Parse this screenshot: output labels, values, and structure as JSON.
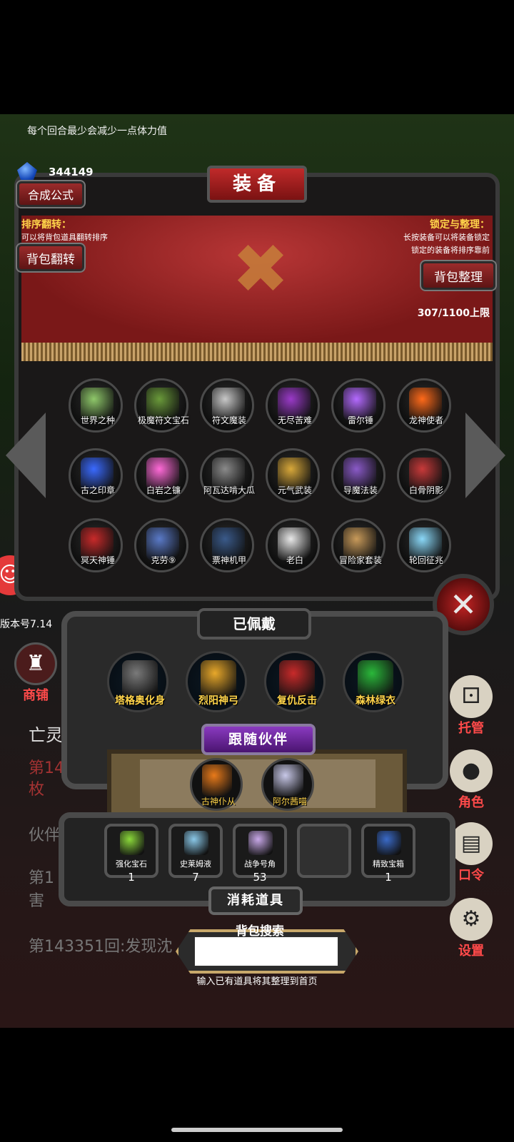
{
  "hint": "每个回合最少会减少一点体力值",
  "currency": {
    "icon": "blue-gem-icon",
    "amount": "344149"
  },
  "header": {
    "title": "装备",
    "craft_button": "合成公式"
  },
  "left_info": {
    "title": "排序翻转：",
    "desc": "可以将背包道具翻转排序",
    "button": "背包翻转"
  },
  "right_info": {
    "title": "锁定与整理：",
    "desc1": "长按装备可以将装备锁定",
    "desc2": "锁定的装备将排序靠前",
    "button": "背包整理"
  },
  "capacity": "307/1100上限",
  "equipment": [
    {
      "name": "世界之种",
      "color": "#8fc86a"
    },
    {
      "name": "极魔符文宝石",
      "color": "#6a9a3a"
    },
    {
      "name": "符文魔装",
      "color": "#c8c8c8"
    },
    {
      "name": "无尽苦难",
      "color": "#9a3ac8"
    },
    {
      "name": "雷尔锤",
      "color": "#b46aff"
    },
    {
      "name": "龙神使者",
      "color": "#ff6a1a"
    },
    {
      "name": "古之印章",
      "color": "#3a6aff"
    },
    {
      "name": "白岩之镰",
      "color": "#ff6ad8"
    },
    {
      "name": "阿瓦达啃大瓜",
      "color": "#8a8a8a"
    },
    {
      "name": "元气武装",
      "color": "#d8a83a"
    },
    {
      "name": "导魔法装",
      "color": "#8a5ac8"
    },
    {
      "name": "白骨阴影",
      "color": "#c83a3a"
    },
    {
      "name": "冥天神锤",
      "color": "#c82a2a"
    },
    {
      "name": "克劳⑨",
      "color": "#5a7ac8"
    },
    {
      "name": "票神机甲",
      "color": "#3a5a8a"
    },
    {
      "name": "老白",
      "color": "#e8e8e8"
    },
    {
      "name": "冒险家套装",
      "color": "#c89a5a"
    },
    {
      "name": "轮回征兆",
      "color": "#8ad8f8"
    }
  ],
  "worn": {
    "title": "已佩戴",
    "items": [
      {
        "name": "塔格奥化身",
        "color": "#7a7a7a"
      },
      {
        "name": "烈阳神弓",
        "color": "#e8a82a"
      },
      {
        "name": "复仇反击",
        "color": "#c82a2a"
      },
      {
        "name": "森林绿衣",
        "color": "#2ab83a"
      }
    ]
  },
  "companions": {
    "title": "跟随伙伴",
    "items": [
      {
        "name": "古神仆从",
        "color": "#e87a1a"
      },
      {
        "name": "阿尔茜喵",
        "color": "#c8c8e8"
      }
    ]
  },
  "consumables": {
    "title": "消耗道具",
    "items": [
      {
        "name": "强化宝石",
        "count": "1",
        "color": "#8ad83a"
      },
      {
        "name": "史莱姆液",
        "count": "7",
        "color": "#8ac8e8"
      },
      {
        "name": "战争号角",
        "count": "53",
        "color": "#c8a8e8"
      },
      {
        "name": "",
        "count": "",
        "color": "#303030"
      },
      {
        "name": "精致宝箱",
        "count": "1",
        "color": "#3a6ac8"
      }
    ]
  },
  "search": {
    "title": "背包搜索",
    "placeholder": "",
    "hint": "输入已有道具将其整理到首页"
  },
  "background": {
    "version": "版本号7.14",
    "shop": "商铺",
    "log1": "亡灵",
    "log2": "第14",
    "log3": "枚",
    "log4": "伙伴",
    "log5": "第1",
    "log6": "害",
    "log7": "第143351回:发现沈"
  },
  "side_buttons": [
    {
      "label": "托管",
      "icon": "dice-icon"
    },
    {
      "label": "角色",
      "icon": "hooded-figure-icon"
    },
    {
      "label": "口令",
      "icon": "scroll-icon"
    },
    {
      "label": "设置",
      "icon": "gear-icon"
    }
  ]
}
